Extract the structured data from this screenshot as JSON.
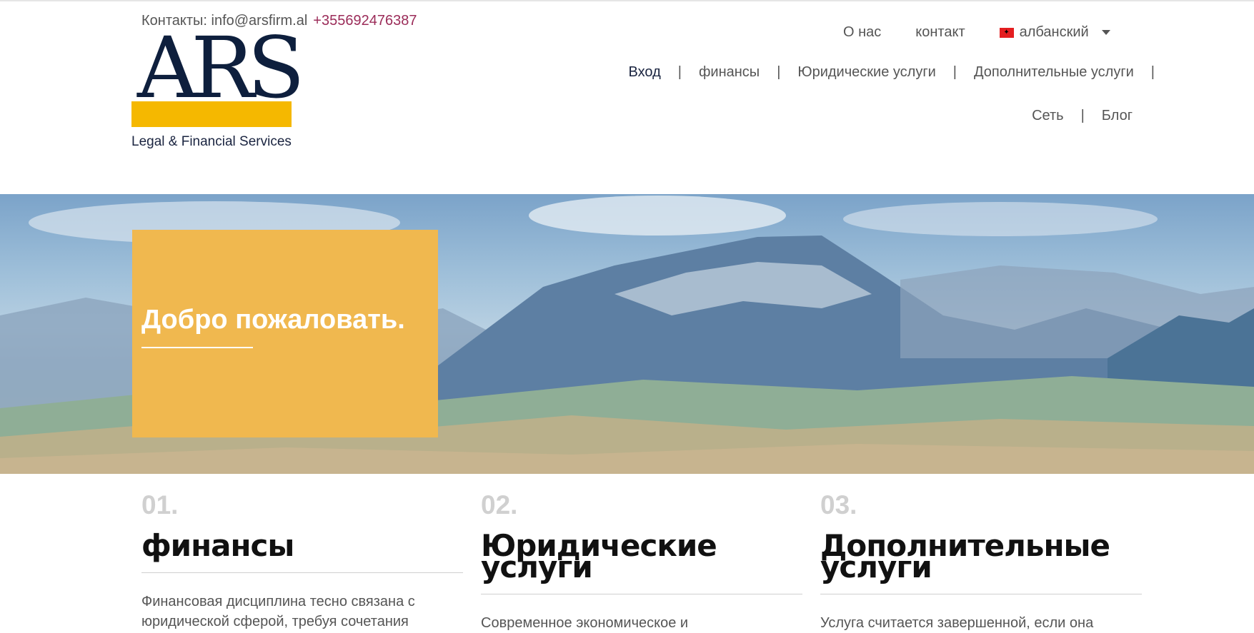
{
  "header": {
    "contacts_label": "Контакты: info@arsfirm.al",
    "phone": "+355692476387",
    "logo_letters": "ARS",
    "logo_tagline": "Legal & Financial Services"
  },
  "nav_top": {
    "about": "О нас",
    "contact": "контакт",
    "language": "албанский"
  },
  "nav_main": {
    "items": [
      "Вход",
      "финансы",
      "Юридические услуги",
      "Дополнительные услуги",
      "Сеть",
      "Блог"
    ],
    "active": "Вход"
  },
  "hero": {
    "title": "Добро пожаловать."
  },
  "columns": [
    {
      "num": "01.",
      "title": "финансы",
      "text": "Финансовая дисциплина тесно связана с юридической сферой, требуя сочетания"
    },
    {
      "num": "02.",
      "title": "Юридические услуги",
      "text": "Современное экономическое и"
    },
    {
      "num": "03.",
      "title": "Дополнительные услуги",
      "text": "Услуга считается завершенной, если она"
    }
  ],
  "colors": {
    "accent_yellow": "#f0b84f",
    "logo_yellow": "#f5b800",
    "logo_navy": "#0e1f3d",
    "phone_color": "#9b2c59"
  }
}
